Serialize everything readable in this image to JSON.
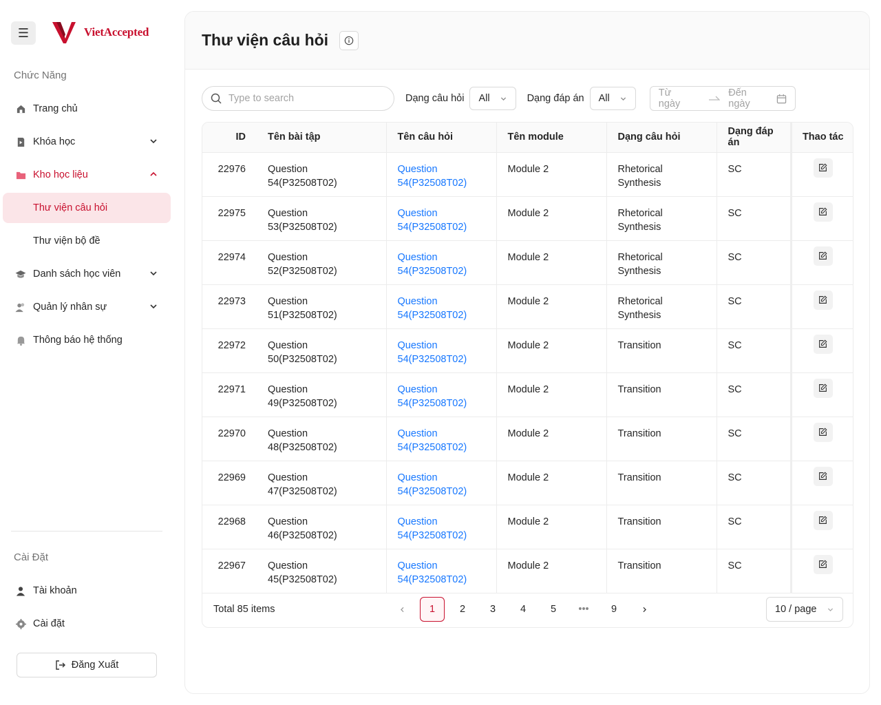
{
  "brand": {
    "name": "VietAccepted"
  },
  "sidebar": {
    "section_function": "Chức Năng",
    "items": [
      {
        "label": "Trang chủ"
      },
      {
        "label": "Khóa học"
      },
      {
        "label": "Kho học liệu"
      },
      {
        "label": "Thư viện câu hỏi"
      },
      {
        "label": "Thư viện bộ đề"
      },
      {
        "label": "Danh sách học viên"
      },
      {
        "label": "Quản lý nhân sự"
      },
      {
        "label": "Thông báo hệ thống"
      }
    ],
    "section_settings": "Cài Đặt",
    "settings_items": [
      {
        "label": "Tài khoản"
      },
      {
        "label": "Cài đặt"
      }
    ],
    "logout_label": "Đăng Xuất"
  },
  "header": {
    "title": "Thư viện câu hỏi"
  },
  "filters": {
    "search_placeholder": "Type to search",
    "question_type_label": "Dạng câu hỏi",
    "question_type_value": "All",
    "answer_type_label": "Dạng đáp án",
    "answer_type_value": "All",
    "date_from_placeholder": "Từ ngày",
    "date_to_placeholder": "Đến ngày"
  },
  "table": {
    "columns": [
      "ID",
      "Tên bài tập",
      "Tên câu hỏi",
      "Tên module",
      "Dạng câu hỏi",
      "Dạng đáp án",
      "Thao tác"
    ],
    "rows": [
      {
        "id": "22976",
        "exercise": "Question 54(P32508T02)",
        "question": "Question 54(P32508T02)",
        "module": "Module 2",
        "qtype": "Rhetorical Synthesis",
        "atype": "SC"
      },
      {
        "id": "22975",
        "exercise": "Question 53(P32508T02)",
        "question": "Question 54(P32508T02)",
        "module": "Module 2",
        "qtype": "Rhetorical Synthesis",
        "atype": "SC"
      },
      {
        "id": "22974",
        "exercise": "Question 52(P32508T02)",
        "question": "Question 54(P32508T02)",
        "module": "Module 2",
        "qtype": "Rhetorical Synthesis",
        "atype": "SC"
      },
      {
        "id": "22973",
        "exercise": "Question 51(P32508T02)",
        "question": "Question 54(P32508T02)",
        "module": "Module 2",
        "qtype": "Rhetorical Synthesis",
        "atype": "SC"
      },
      {
        "id": "22972",
        "exercise": "Question 50(P32508T02)",
        "question": "Question 54(P32508T02)",
        "module": "Module 2",
        "qtype": "Transition",
        "atype": "SC"
      },
      {
        "id": "22971",
        "exercise": "Question 49(P32508T02)",
        "question": "Question 54(P32508T02)",
        "module": "Module 2",
        "qtype": "Transition",
        "atype": "SC"
      },
      {
        "id": "22970",
        "exercise": "Question 48(P32508T02)",
        "question": "Question 54(P32508T02)",
        "module": "Module 2",
        "qtype": "Transition",
        "atype": "SC"
      },
      {
        "id": "22969",
        "exercise": "Question 47(P32508T02)",
        "question": "Question 54(P32508T02)",
        "module": "Module 2",
        "qtype": "Transition",
        "atype": "SC"
      },
      {
        "id": "22968",
        "exercise": "Question 46(P32508T02)",
        "question": "Question 54(P32508T02)",
        "module": "Module 2",
        "qtype": "Transition",
        "atype": "SC"
      },
      {
        "id": "22967",
        "exercise": "Question 45(P32508T02)",
        "question": "Question 54(P32508T02)",
        "module": "Module 2",
        "qtype": "Transition",
        "atype": "SC"
      }
    ]
  },
  "pagination": {
    "total_text": "Total 85 items",
    "pages": [
      "1",
      "2",
      "3",
      "4",
      "5",
      "•••",
      "9"
    ],
    "current": "1",
    "page_size": "10 / page"
  },
  "colors": {
    "brand": "#c8102e",
    "link": "#1677ff",
    "selected_bg": "#fbe5e8"
  }
}
